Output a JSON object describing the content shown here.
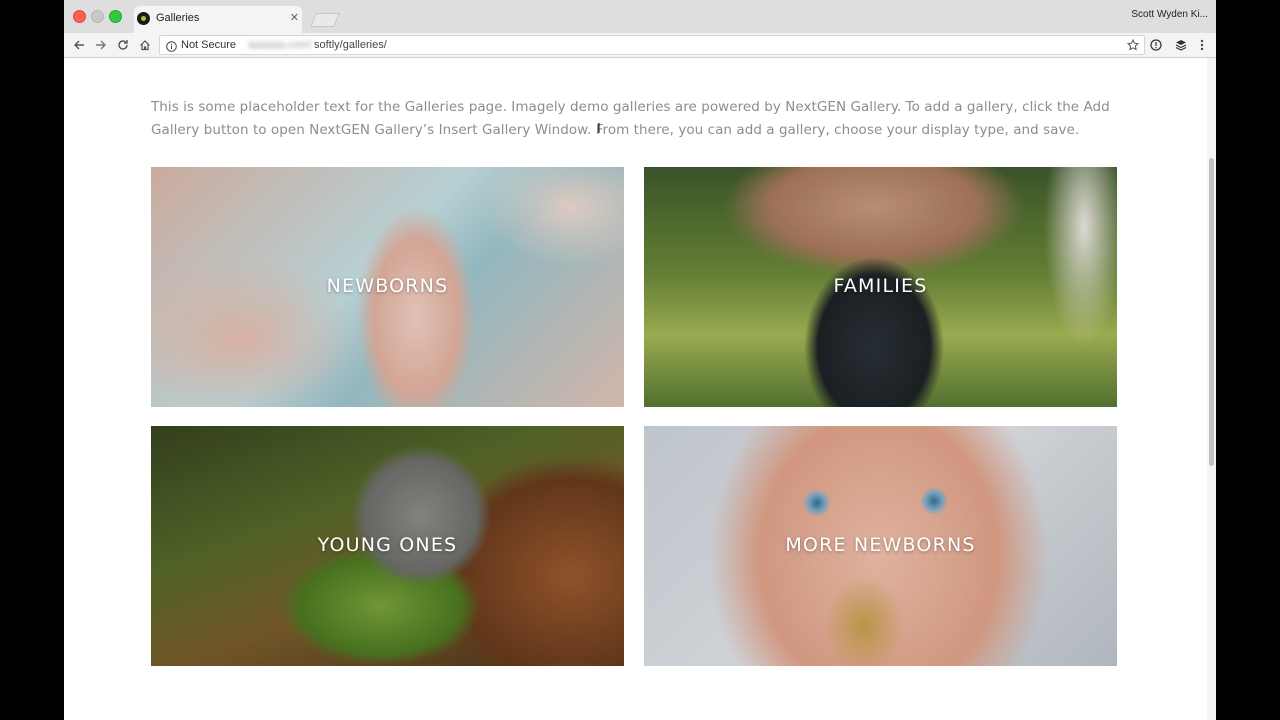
{
  "browser": {
    "tab": {
      "title": "Galleries",
      "close_icon": "close-icon",
      "favicon": "site-favicon"
    },
    "profile_name": "Scott Wyden Ki...",
    "address_bar": {
      "security_label": "Not Secure",
      "host_blurred": "aaaaaa.com/",
      "path": "softly/galleries/"
    },
    "icons": [
      "back-arrow-icon",
      "forward-arrow-icon",
      "reload-icon",
      "home-icon",
      "info-icon",
      "star-icon",
      "extension-icon",
      "layers-icon",
      "menu-icon"
    ]
  },
  "page": {
    "intro_text": "This is some placeholder text for the Galleries page. Imagely demo galleries are powered by NextGEN Gallery. To add a gallery, click the Add Gallery button to open NextGEN Gallery’s Insert Gallery Window. From there, you can add a gallery, choose your display type, and save.",
    "galleries": [
      {
        "label": "NEWBORNS"
      },
      {
        "label": "FAMILIES"
      },
      {
        "label": "YOUNG ONES"
      },
      {
        "label": "MORE NEWBORNS"
      }
    ]
  },
  "colors": {
    "text_muted": "#8d8d8d",
    "tab_strip": "#dedede",
    "toolbar": "#f4f4f4",
    "close_light": "#fc5f57",
    "zoom_light": "#31c93f"
  }
}
